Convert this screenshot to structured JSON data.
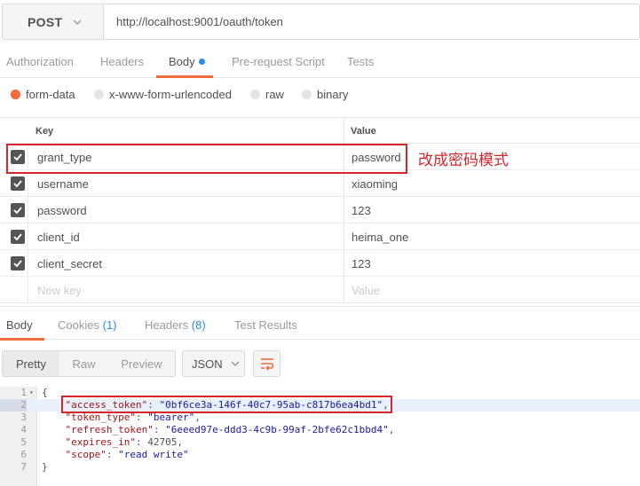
{
  "request": {
    "method": "POST",
    "url": "http://localhost:9001/oauth/token"
  },
  "request_tabs": [
    {
      "label": "Authorization"
    },
    {
      "label": "Headers"
    },
    {
      "label": "Body"
    },
    {
      "label": "Pre-request Script"
    },
    {
      "label": "Tests"
    }
  ],
  "body_types": [
    {
      "label": "form-data"
    },
    {
      "label": "x-www-form-urlencoded"
    },
    {
      "label": "raw"
    },
    {
      "label": "binary"
    }
  ],
  "table": {
    "key_header": "Key",
    "value_header": "Value",
    "rows": [
      {
        "key": "grant_type",
        "value": "password"
      },
      {
        "key": "username",
        "value": "xiaoming"
      },
      {
        "key": "password",
        "value": "123"
      },
      {
        "key": "client_id",
        "value": "heima_one"
      },
      {
        "key": "client_secret",
        "value": "123"
      }
    ],
    "new_key_placeholder": "New key",
    "new_value_placeholder": "Value"
  },
  "annotation": "改成密码模式",
  "response_tabs": [
    {
      "label": "Body",
      "count": ""
    },
    {
      "label": "Cookies",
      "count": "(1)"
    },
    {
      "label": "Headers",
      "count": "(8)"
    },
    {
      "label": "Test Results",
      "count": ""
    }
  ],
  "view_modes": [
    "Pretty",
    "Raw",
    "Preview"
  ],
  "format": "JSON",
  "response_lines": [
    {
      "n": "1",
      "fold": "▾",
      "key": "",
      "sep": "",
      "val": "",
      "text": "{"
    },
    {
      "n": "2",
      "key": "\"access_token\"",
      "val": "\"0bf6ce3a-146f-40c7-95ab-c817b6ea4bd1\"",
      "end": ","
    },
    {
      "n": "3",
      "key": "\"token_type\"",
      "val": "\"bearer\"",
      "end": ","
    },
    {
      "n": "4",
      "key": "\"refresh_token\"",
      "val": "\"6eeed97e-ddd3-4c9b-99af-2bfe62c1bbd4\"",
      "end": ","
    },
    {
      "n": "5",
      "key": "\"expires_in\"",
      "val": "42705",
      "end": ","
    },
    {
      "n": "6",
      "key": "\"scope\"",
      "val": "\"read write\"",
      "end": ""
    },
    {
      "n": "7",
      "text": "}"
    }
  ]
}
